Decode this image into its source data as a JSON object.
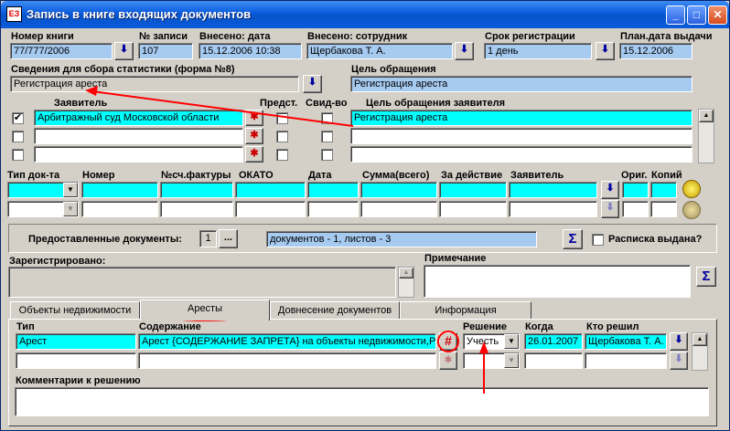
{
  "window": {
    "title": "Запись в книге входящих документов",
    "app_icon": "ЕЗ"
  },
  "header": {
    "book_number_label": "Номер книги",
    "book_number": "77/777/2006",
    "record_no_label": "№ записи",
    "record_no": "107",
    "entered_date_label": "Внесено: дата",
    "entered_date": "15.12.2006 10:38",
    "entered_by_label": "Внесено: сотрудник",
    "entered_by": "Щербакова Т. А.",
    "reg_term_label": "Срок регистрации",
    "reg_term": "1 день",
    "issue_date_label": "План.дата выдачи",
    "issue_date": "15.12.2006",
    "stats_label": "Сведения для сбора статистики (форма №8)",
    "stats_value": "Регистрация ареста",
    "purpose_label": "Цель обращения",
    "purpose_value": "Регистрация ареста"
  },
  "applicants": {
    "col_applicant": "Заявитель",
    "col_rep": "Предст.",
    "col_cert": "Свид-во",
    "col_purpose": "Цель обращения заявителя",
    "rows": [
      {
        "name": "Арбитражный суд Московской области",
        "purpose": "Регистрация ареста",
        "checked": "✔"
      },
      {
        "name": "",
        "purpose": "",
        "checked": ""
      },
      {
        "name": "",
        "purpose": "",
        "checked": ""
      }
    ]
  },
  "docs_table": {
    "cols": [
      "Тип док-та",
      "Номер",
      "№сч.фактуры",
      "ОКАТО",
      "Дата",
      "Сумма(всего)",
      "За действие",
      "Заявитель",
      "Ориг.",
      "Копий"
    ]
  },
  "provided": {
    "label": "Предоставленные документы:",
    "count": "1",
    "browse": "...",
    "summary": "документов - 1, листов - 3",
    "receipt_label": "Расписка выдана?",
    "sigma": "Σ"
  },
  "registered_label": "Зарегистрировано:",
  "note_label": "Примечание",
  "tabs": [
    "Объекты недвижимости",
    "Аресты",
    "Довнесение документов",
    "Информация"
  ],
  "arrests": {
    "col_type": "Тип",
    "col_content": "Содержание",
    "col_decision": "Решение",
    "col_when": "Когда",
    "col_who": "Кто решил",
    "rows": [
      {
        "type": "Арест",
        "content": "Арест {СОДЕРЖАНИЕ ЗАПРЕТА}  на объекты недвижимости,РАСПОЛОЖЕННЫЕ",
        "decision": "Учесть",
        "when": "26.01.2007",
        "who": "Щербакова Т. А."
      }
    ],
    "hash_icon": "#",
    "comment_label": "Комментарии к решению"
  }
}
